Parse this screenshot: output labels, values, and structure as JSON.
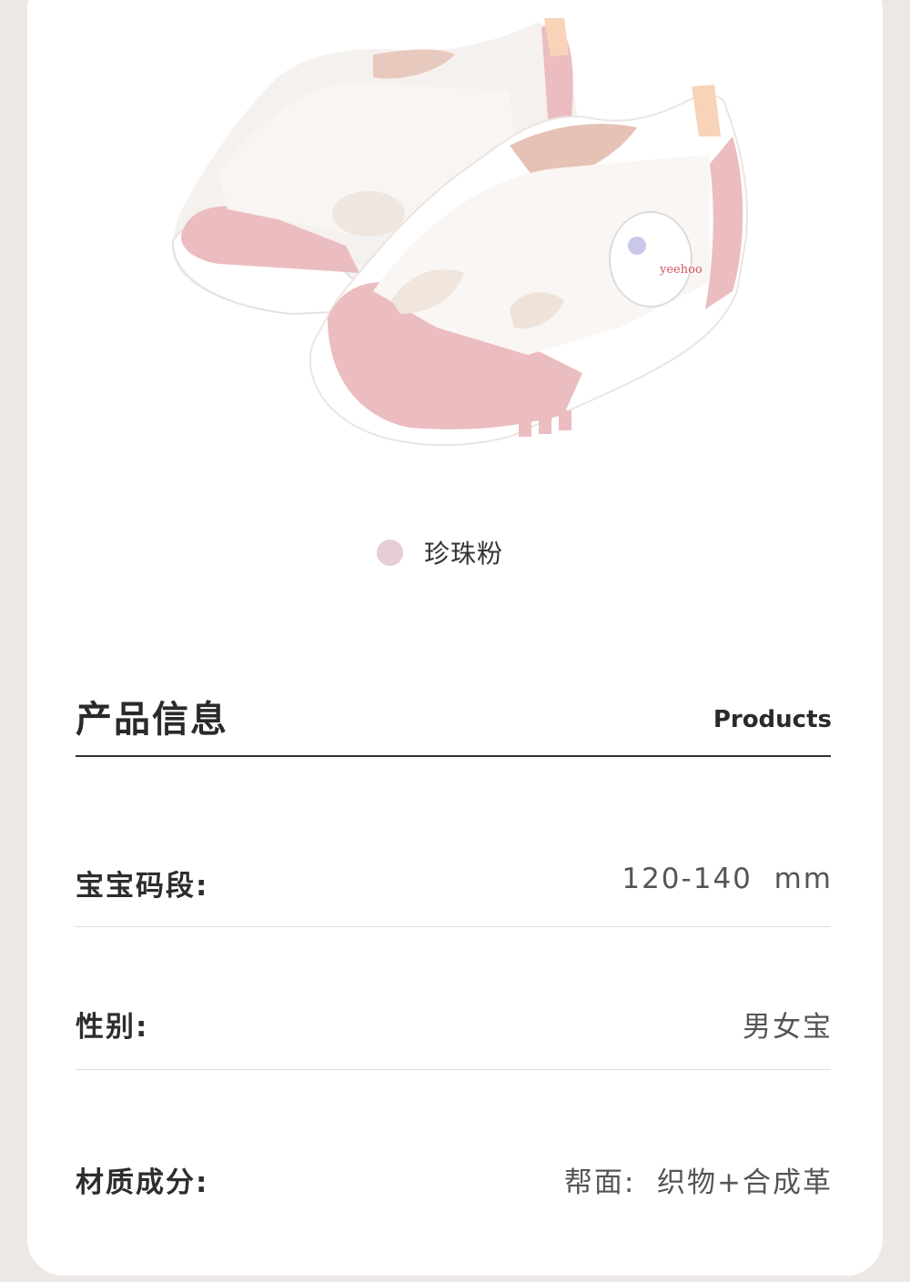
{
  "colors": {
    "page_bg": "#ece8e5",
    "card_bg": "#ffffff",
    "swatch": "#e5cfd4",
    "title": "#2a2a2a",
    "value_text": "#555555"
  },
  "product_image": {
    "icon": "baby-sandal-pair-illustration",
    "badge_text": "yeehoo"
  },
  "color_option": {
    "label": "珍珠粉"
  },
  "section": {
    "title": "产品信息",
    "subtitle": "Products"
  },
  "info_rows": [
    {
      "label": "宝宝码段:",
      "value": "120-140  mm"
    },
    {
      "label": "性别:",
      "value": "男女宝"
    },
    {
      "label": "材质成分:",
      "value": "帮面:  织物+合成革"
    }
  ]
}
